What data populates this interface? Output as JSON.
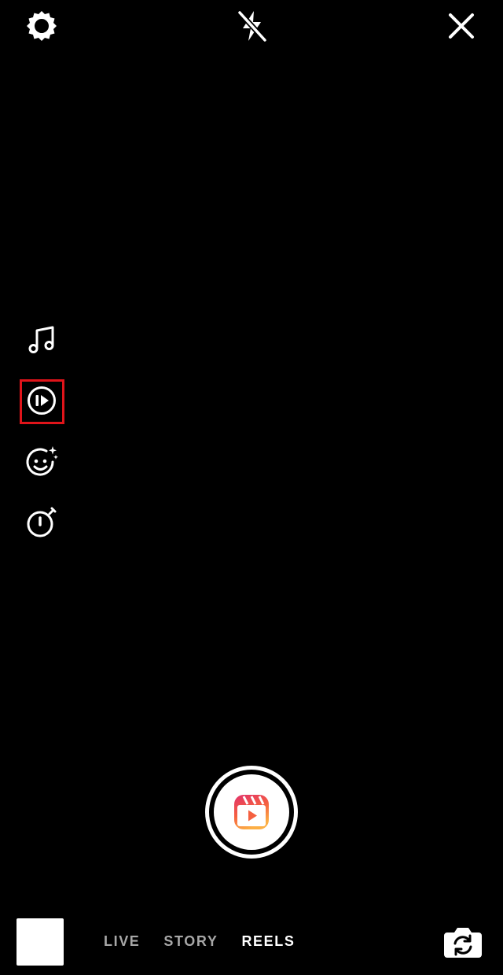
{
  "top_bar": {
    "settings_icon": "gear-icon",
    "flash_icon": "flash-off-icon",
    "close_icon": "close-icon"
  },
  "tools": [
    {
      "icon": "music-note-icon"
    },
    {
      "icon": "speed-icon"
    },
    {
      "icon": "effects-icon"
    },
    {
      "icon": "timer-icon"
    }
  ],
  "modes": {
    "live": "LIVE",
    "story": "STORY",
    "reels": "REELS"
  },
  "selected_mode": "REELS",
  "colors": {
    "background": "#000000",
    "highlight": "#e0141a",
    "inactive_mode": "#a7a7a7",
    "reels_gradient_top": "#e1306c",
    "reels_gradient_bottom": "#fcaf45"
  }
}
